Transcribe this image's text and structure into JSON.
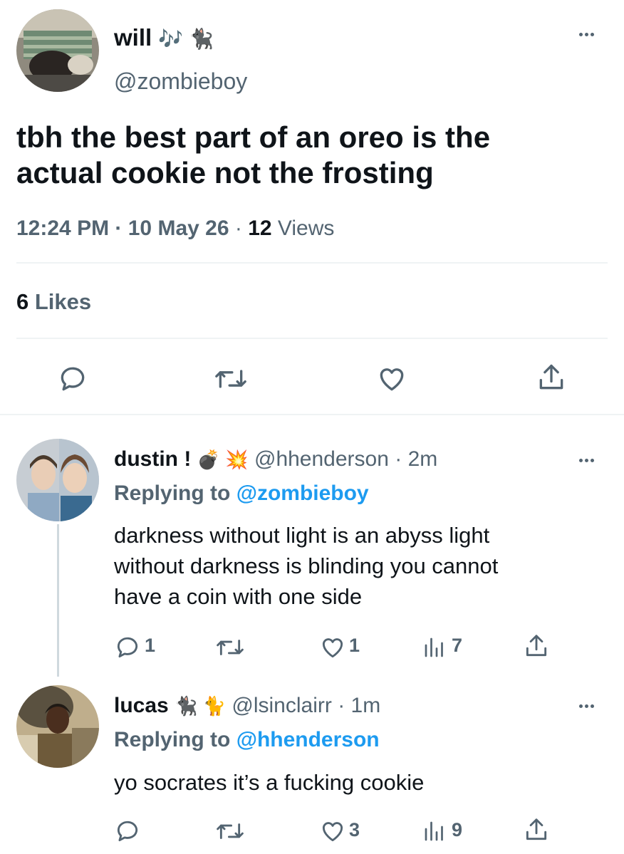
{
  "main_tweet": {
    "display_name": "will",
    "name_emoji": "🎶 🐈‍⬛",
    "handle": "@zombieboy",
    "text_line1": "tbh the best part of an oreo is the",
    "text_line2": "actual cookie not the frosting",
    "time": "12:24 PM",
    "date": "10 May 26",
    "views_count": "12",
    "views_label": "Views",
    "likes_count": "6",
    "likes_label": "Likes"
  },
  "replies": [
    {
      "display_name": "dustin !",
      "name_emoji": "💣 💥",
      "handle": "@hhenderson",
      "age": "2m",
      "replying_prefix": "Replying to",
      "replying_to": "@zombieboy",
      "text_line1": "darkness without light is an abyss light",
      "text_line2": "without darkness is blinding you cannot",
      "text_line3": "have a coin with one side",
      "reply_count": "1",
      "like_count": "1",
      "view_count": "7"
    },
    {
      "display_name": "lucas",
      "name_emoji": "🐈‍⬛ 🐈",
      "handle": "@lsinclairr",
      "age": "1m",
      "replying_prefix": "Replying to",
      "replying_to": "@hhenderson",
      "text_line1": "yo socrates it’s a fucking cookie",
      "like_count": "3",
      "view_count": "9"
    }
  ],
  "colors": {
    "text": "#0f1419",
    "secondary": "#536471",
    "accent": "#1d9bf0",
    "divider": "#eff3f4"
  }
}
